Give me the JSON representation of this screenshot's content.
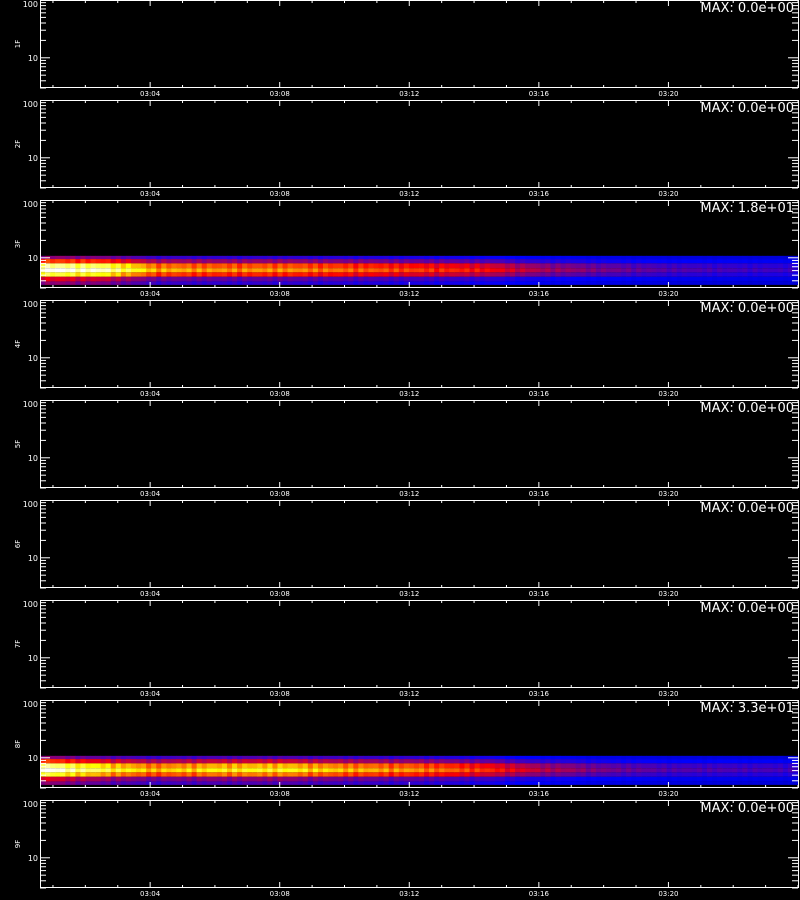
{
  "chart_data": {
    "type": "heatmap",
    "x_ticks": [
      "03:04",
      "03:08",
      "03:12",
      "03:16",
      "03:20"
    ],
    "x_tick_minutes": [
      4,
      8,
      12,
      16,
      20
    ],
    "xlim_minutes": [
      0.6,
      24
    ],
    "yscale": "log",
    "ylim": [
      3,
      100
    ],
    "y_ticks": [
      "10",
      "100"
    ],
    "colormap": [
      "#000000",
      "#0000ff",
      "#ff0000",
      "#ffff00",
      "#ffffff"
    ],
    "panels": [
      {
        "ylabel": "1F",
        "max_label": "MAX: 0.0e+00",
        "max": 0,
        "band_center": 5.5,
        "profile": []
      },
      {
        "ylabel": "2F",
        "max_label": "MAX: 0.0e+00",
        "max": 0,
        "band_center": 5.5,
        "profile": []
      },
      {
        "ylabel": "3F",
        "max_label": "MAX: 1.8e+01",
        "max": 18,
        "band_center": 5.5,
        "profile": [
          [
            0.6,
            1.0
          ],
          [
            2.5,
            0.9
          ],
          [
            4,
            0.6
          ],
          [
            6,
            0.55
          ],
          [
            8,
            0.55
          ],
          [
            10,
            0.5
          ],
          [
            12,
            0.45
          ],
          [
            14,
            0.4
          ],
          [
            16,
            0.28
          ],
          [
            18,
            0.22
          ],
          [
            20,
            0.18
          ],
          [
            22,
            0.16
          ],
          [
            24,
            0.15
          ]
        ]
      },
      {
        "ylabel": "4F",
        "max_label": "MAX: 0.0e+00",
        "max": 0,
        "band_center": 5.5,
        "profile": []
      },
      {
        "ylabel": "5F",
        "max_label": "MAX: 0.0e+00",
        "max": 0,
        "band_center": 5.5,
        "profile": []
      },
      {
        "ylabel": "6F",
        "max_label": "MAX: 0.0e+00",
        "max": 0,
        "band_center": 5.5,
        "profile": []
      },
      {
        "ylabel": "7F",
        "max_label": "MAX: 0.0e+00",
        "max": 0,
        "band_center": 5.5,
        "profile": []
      },
      {
        "ylabel": "8F",
        "max_label": "MAX: 3.3e+01",
        "max": 33,
        "band_center": 5.5,
        "profile": [
          [
            0.6,
            1.0
          ],
          [
            2,
            0.8
          ],
          [
            4,
            0.6
          ],
          [
            6,
            0.68
          ],
          [
            8,
            0.7
          ],
          [
            10,
            0.6
          ],
          [
            12,
            0.55
          ],
          [
            14,
            0.45
          ],
          [
            16,
            0.3
          ],
          [
            18,
            0.22
          ],
          [
            20,
            0.18
          ],
          [
            22,
            0.17
          ],
          [
            24,
            0.16
          ]
        ]
      },
      {
        "ylabel": "9F",
        "max_label": "MAX: 0.0e+00",
        "max": 0,
        "band_center": 5.5,
        "profile": []
      }
    ]
  }
}
